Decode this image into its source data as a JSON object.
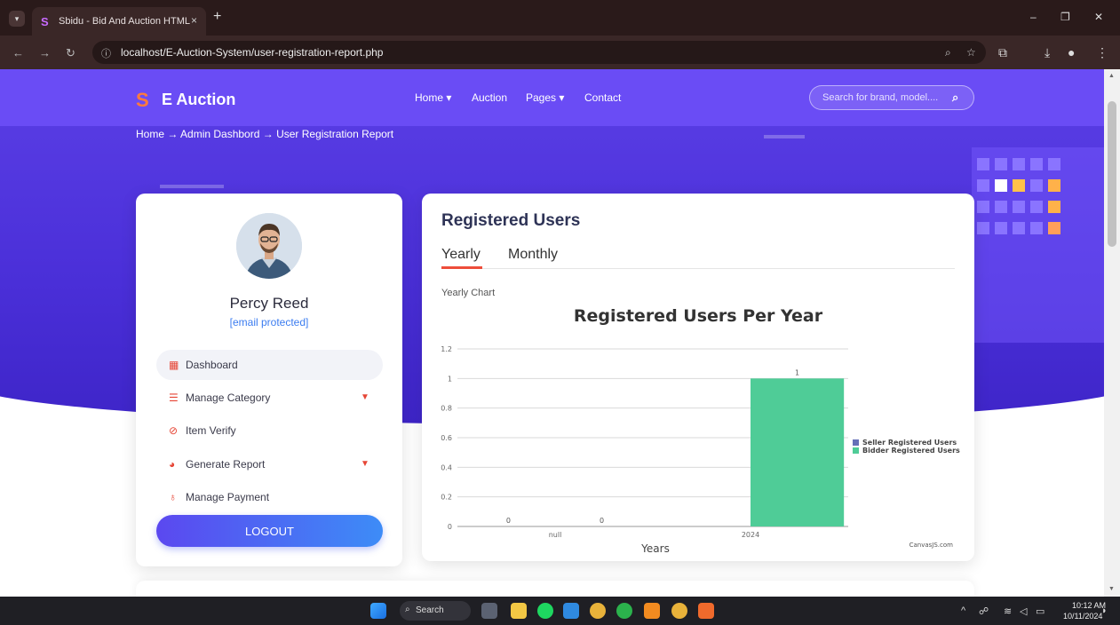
{
  "browser": {
    "tab_title": "Sbidu - Bid And Auction HTML",
    "tab_close": "×",
    "new_tab": "+",
    "url": "localhost/E-Auction-System/user-registration-report.php",
    "minimize": "–",
    "restore": "❐",
    "close": "✕"
  },
  "site": {
    "logo_glyph": "S",
    "brand": "E Auction",
    "nav": [
      {
        "label": "Home ▾"
      },
      {
        "label": "Auction"
      },
      {
        "label": "Pages ▾"
      },
      {
        "label": "Contact"
      }
    ],
    "search_placeholder": "Search for brand, model....",
    "breadcrumb": "Home → Admin Dashbord → User Registration Report"
  },
  "profile": {
    "name": "Percy Reed",
    "email": "[email protected]",
    "menu": [
      {
        "label": "Dashboard",
        "icon": "dashboard-icon",
        "glyph": "▦",
        "caret": ""
      },
      {
        "label": "Manage Category",
        "icon": "list-icon",
        "glyph": "☰",
        "caret": "▼"
      },
      {
        "label": "Item Verify",
        "icon": "check-circle-icon",
        "glyph": "⊘",
        "caret": ""
      },
      {
        "label": "Generate Report",
        "icon": "pie-chart-icon",
        "glyph": "◕",
        "caret": "▼"
      },
      {
        "label": "Manage Payment",
        "icon": "payment-icon",
        "glyph": "♁",
        "caret": ""
      }
    ],
    "logout_label": "LOGOUT"
  },
  "report": {
    "title": "Registered Users",
    "tabs": [
      {
        "label": "Yearly"
      },
      {
        "label": "Monthly"
      }
    ],
    "active_tab": "Yearly",
    "caption": "Yearly Chart",
    "credit": "CanvasJS.com"
  },
  "chart_data": {
    "type": "bar",
    "title": "Registered Users Per Year",
    "xlabel": "Years",
    "ylabel": "",
    "categories": [
      "null",
      "2024"
    ],
    "ylim": [
      0,
      1.2
    ],
    "yticks": [
      "0",
      "0.2",
      "0.4",
      "0.6",
      "0.8",
      "1",
      "1.2"
    ],
    "grid": true,
    "legend_position": "right",
    "series": [
      {
        "name": "Seller Registered Users",
        "values": [
          0,
          0
        ],
        "labels": [
          "0",
          ""
        ],
        "color": "#6670b8"
      },
      {
        "name": "Bidder Registered Users",
        "values": [
          0,
          1
        ],
        "labels": [
          "0",
          "1"
        ],
        "color": "#4fcc97"
      }
    ]
  },
  "taskbar": {
    "search_label": "Search",
    "time": "10:12 AM",
    "date": "10/11/2024"
  },
  "colors": {
    "brand_purple": "#6a4cf5",
    "accent_red": "#e64535",
    "link_blue": "#3b7cf0"
  }
}
